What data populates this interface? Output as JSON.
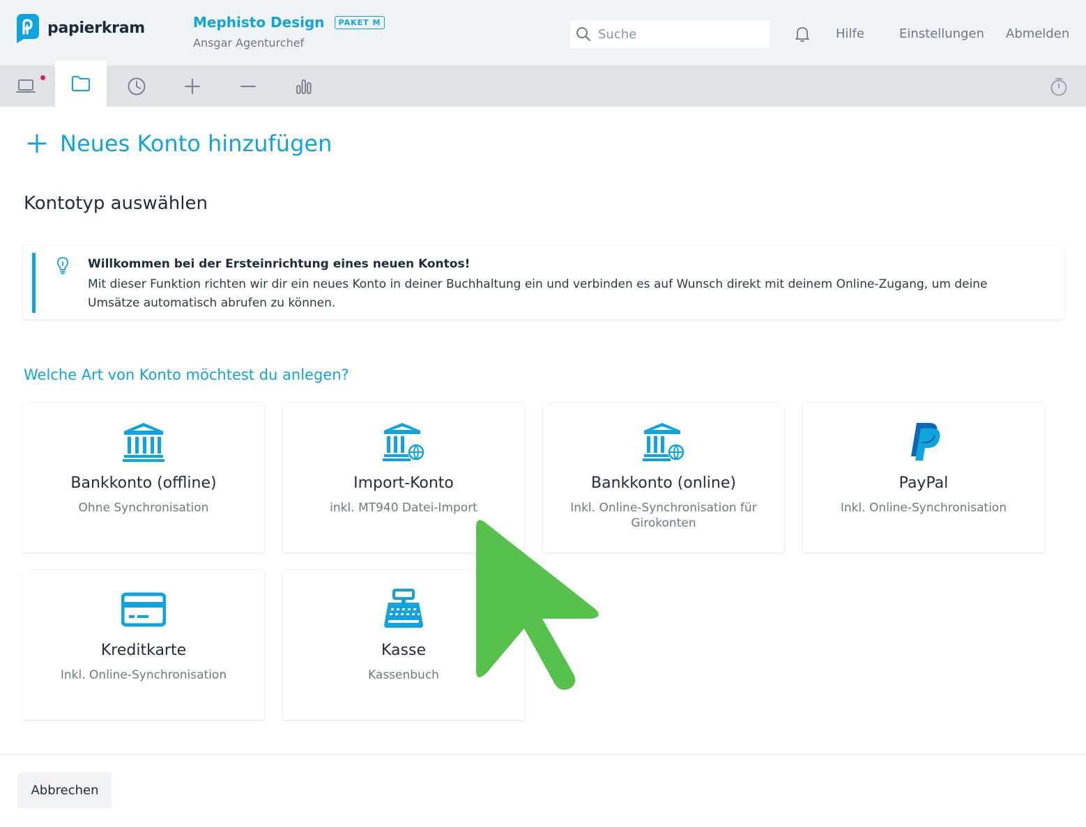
{
  "header": {
    "logo_text": "papierkram",
    "company_name": "Mephisto Design",
    "plan_badge": "PAKET M",
    "user_name": "Ansgar Agenturchef",
    "search_placeholder": "Suche",
    "nav": {
      "help": "Hilfe",
      "settings": "Einstellungen",
      "logout": "Abmelden"
    }
  },
  "toolbar": {
    "items": [
      "laptop-icon",
      "folder-icon",
      "clock-icon",
      "plus-icon",
      "minus-icon",
      "bar-chart-icon"
    ],
    "active": "folder-icon",
    "right_item": "stopwatch-icon",
    "notification": true
  },
  "page": {
    "title": "Neues Konto hinzufügen",
    "section_title": "Kontotyp auswählen",
    "info": {
      "title": "Willkommen bei der Ersteinrichtung eines neuen Kontos!",
      "text": "Mit dieser Funktion richten wir dir ein neues Konto in deiner Buchhaltung ein und verbinden es auf Wunsch direkt mit deinem Online-Zugang, um deine Umsätze automatisch abrufen zu können."
    },
    "question": "Welche Art von Konto möchtest du anlegen?",
    "cards": [
      {
        "title": "Bankkonto (offline)",
        "subtitle": "Ohne Synchronisation",
        "icon": "bank-icon"
      },
      {
        "title": "Import-Konto",
        "subtitle": "inkl. MT940 Datei-Import",
        "icon": "bank-globe-icon"
      },
      {
        "title": "Bankkonto (online)",
        "subtitle": "Inkl. Online-Synchronisation für Girokonten",
        "icon": "bank-globe-icon"
      },
      {
        "title": "PayPal",
        "subtitle": "Inkl. Online-Synchronisation",
        "icon": "paypal-icon"
      },
      {
        "title": "Kreditkarte",
        "subtitle": "Inkl. Online-Synchronisation",
        "icon": "credit-card-icon"
      },
      {
        "title": "Kasse",
        "subtitle": "Kassenbuch",
        "icon": "cash-register-icon"
      }
    ],
    "cancel_label": "Abbrechen"
  },
  "colors": {
    "accent": "#0fa3e0",
    "header_bg": "#f0f3f6",
    "toolbar_bg": "#e0e4e7",
    "cursor": "#56c14b",
    "notification": "#e5185f"
  }
}
